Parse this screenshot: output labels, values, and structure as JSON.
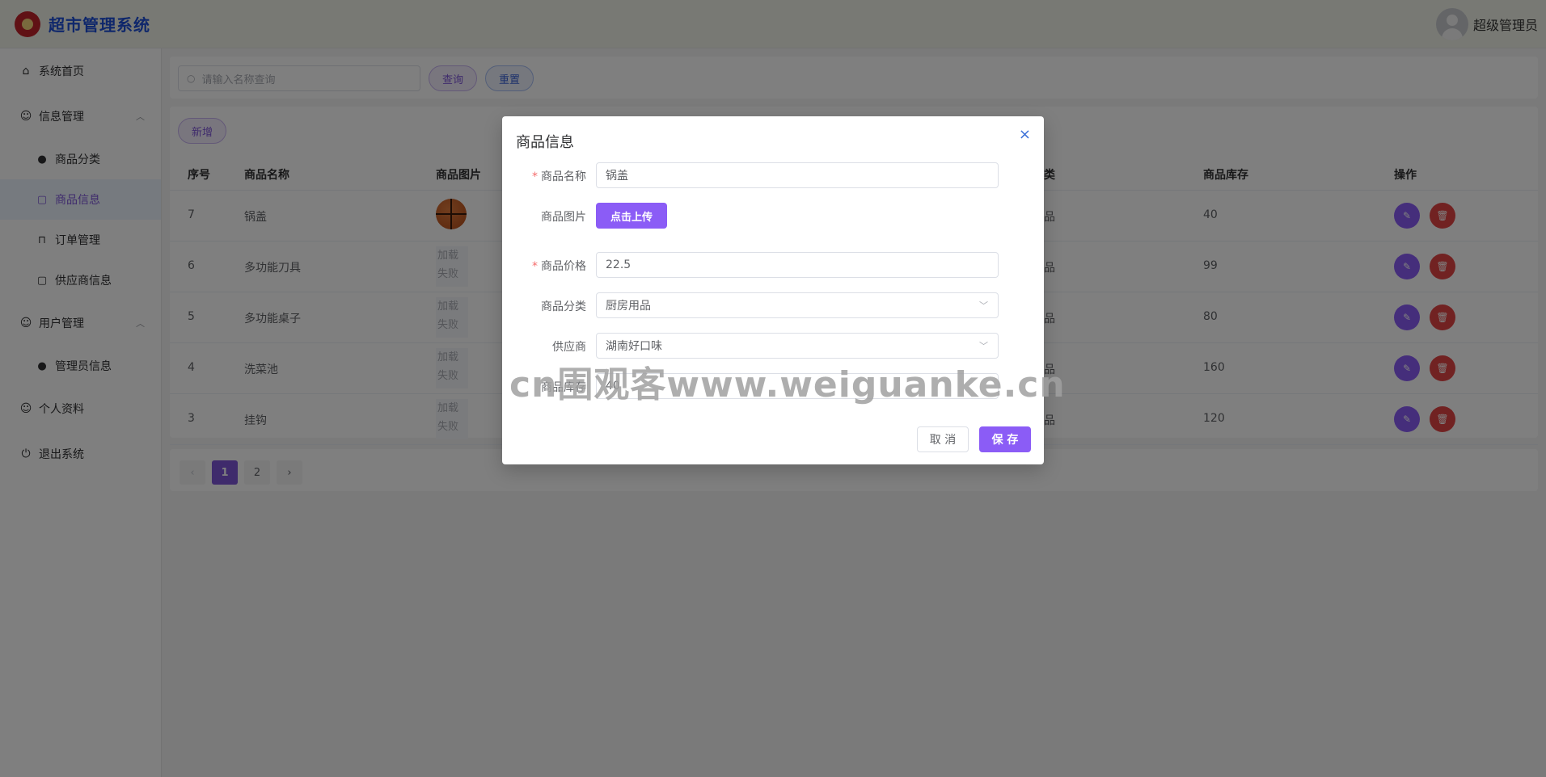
{
  "header": {
    "app_title": "超市管理系统",
    "user_name": "超级管理员"
  },
  "sidebar": {
    "home": "系统首页",
    "info_group": "信息管理",
    "info_items": [
      "商品分类",
      "商品信息",
      "订单管理",
      "供应商信息"
    ],
    "user_group": "用户管理",
    "user_items": [
      "管理员信息"
    ],
    "profile": "个人资料",
    "logout": "退出系统",
    "active_item": "商品信息"
  },
  "search": {
    "placeholder": "请输入名称查询",
    "query_label": "查询",
    "reset_label": "重置"
  },
  "table": {
    "add_label": "新增",
    "columns": [
      "序号",
      "商品名称",
      "商品图片",
      "类",
      "商品库存",
      "操作"
    ],
    "image_fail_text": "加载\n失败",
    "rows": [
      {
        "id": "7",
        "name": "锅盖",
        "category_tail": "品",
        "stock": "40",
        "has_image": true
      },
      {
        "id": "6",
        "name": "多功能刀具",
        "category_tail": "品",
        "stock": "99",
        "has_image": false
      },
      {
        "id": "5",
        "name": "多功能桌子",
        "category_tail": "品",
        "stock": "80",
        "has_image": false
      },
      {
        "id": "4",
        "name": "洗菜池",
        "category_tail": "品",
        "stock": "160",
        "has_image": false
      },
      {
        "id": "3",
        "name": "挂钩",
        "category_tail": "品",
        "stock": "120",
        "has_image": false
      }
    ]
  },
  "pagination": {
    "prev": "‹",
    "pages": [
      "1",
      "2"
    ],
    "current": "1",
    "next": "›"
  },
  "dialog": {
    "title": "商品信息",
    "close": "×",
    "name_label": "商品名称",
    "name_value": "锅盖",
    "image_label": "商品图片",
    "upload_label": "点击上传",
    "price_label": "商品价格",
    "price_value": "22.5",
    "category_label": "商品分类",
    "category_value": "厨房用品",
    "supplier_label": "供应商",
    "supplier_value": "湖南好口味",
    "stock_label": "商品库存",
    "stock_value": "40",
    "cancel_label": "取 消",
    "save_label": "保 存"
  },
  "watermark": "cn围观客www.weiguanke.cn",
  "colors": {
    "primary": "#8b5cf6",
    "danger": "#e24444",
    "title_blue": "#1f4fd6"
  }
}
